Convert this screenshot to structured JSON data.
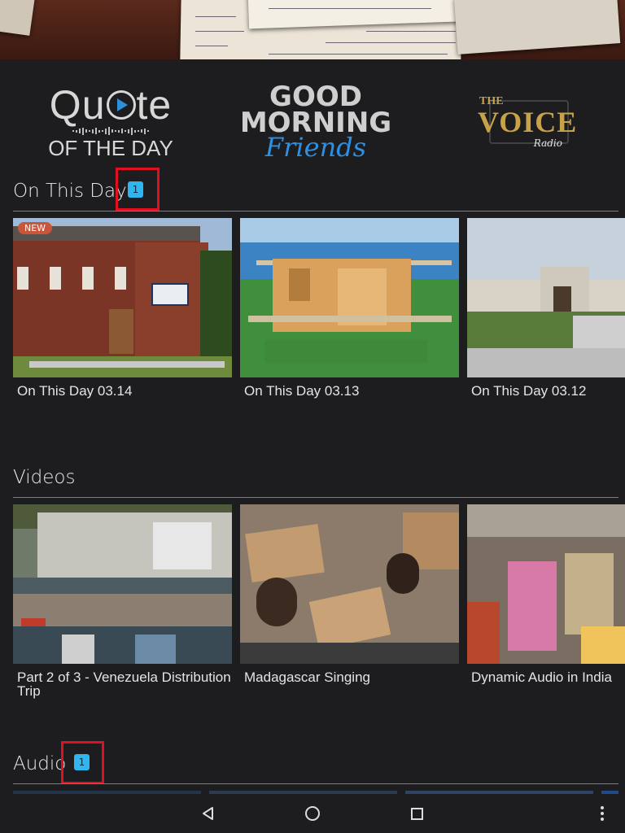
{
  "logos": {
    "quote": {
      "line1_pre": "Qu",
      "line1_post": "te",
      "line2": "OF THE DAY"
    },
    "gmf": {
      "line1": "GOOD",
      "line2": "MORNING",
      "line3": "Friends"
    },
    "voice": {
      "the": "THE",
      "main": "VOICE",
      "radio": "Radio"
    }
  },
  "sections": {
    "on_this_day": {
      "title": "On This Day",
      "badge": "1",
      "cards": [
        {
          "label": "On This Day 03.14",
          "new": "NEW"
        },
        {
          "label": "On This Day 03.13"
        },
        {
          "label": "On This Day 03.12"
        }
      ]
    },
    "videos": {
      "title": "Videos",
      "cards": [
        {
          "label": "Part 2 of 3 - Venezuela Distribution Trip"
        },
        {
          "label": "Madagascar Singing"
        },
        {
          "label": "Dynamic Audio in India"
        }
      ]
    },
    "audio": {
      "title": "Audio",
      "badge": "1"
    }
  },
  "colors": {
    "background": "#1d1d1f",
    "accent_rule": "#3a8fd3",
    "badge": "#2fb6f0",
    "highlight_box": "#e10f1f",
    "new_badge": "#c9553a"
  },
  "icons": {
    "nav_back": "back-triangle-icon",
    "nav_home": "home-circle-icon",
    "nav_recent": "recent-square-icon",
    "nav_more": "more-vert-icon"
  }
}
